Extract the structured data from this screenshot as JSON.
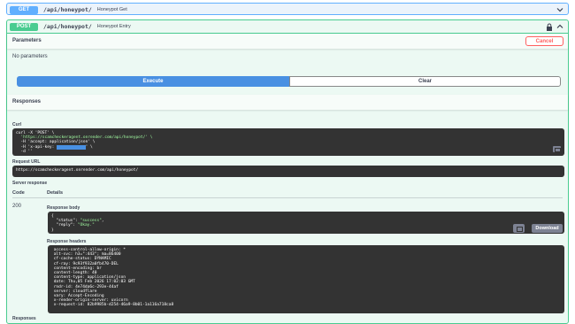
{
  "get_endpoint": {
    "method": "GET",
    "path": "/api/honeypot/",
    "summary": "Honeypot Get"
  },
  "post_endpoint": {
    "method": "POST",
    "path": "/api/honeypot/",
    "summary": "Honeypot Entry"
  },
  "parameters": {
    "title": "Parameters",
    "cancel_label": "Cancel",
    "empty_text": "No parameters"
  },
  "actions": {
    "execute_label": "Execute",
    "clear_label": "Clear"
  },
  "responses": {
    "title": "Responses",
    "curl_label": "Curl",
    "curl_lines": [
      "curl -X 'POST' \\",
      "  'https://scamcheckeragent.onrender.com/api/honeypot/' \\",
      "  -H 'accept: application/json' \\",
      "  -H 'x-api-key: ",
      "' \\",
      "  -d ''"
    ],
    "request_url_label": "Request URL",
    "request_url": "https://scamcheckeragent.onrender.com/api/honeypot/",
    "server_response_label": "Server response",
    "code_header": "Code",
    "details_header": "Details",
    "status_code": "200",
    "response_body_label": "Response body",
    "response_body_lines": [
      "{",
      "  \"status\": ",
      "\"success\"",
      ",",
      "  \"reply\": ",
      "\"Okay.\"",
      "}"
    ],
    "download_label": "Download",
    "response_headers_label": "Response headers",
    "response_headers": [
      " access-control-allow-origin: *",
      " alt-svc: h3=\":443\"; ma=86400",
      " cf-cache-status: DYNAMIC",
      " cf-ray: 9c93f932a0fb470-DEL",
      " content-encoding: br",
      " content-length: 40",
      " content-type: application/json",
      " date: Thu,05 Feb 2026 17:02:03 GMT",
      " rndr-id: 4e74da6c-293e-44af",
      " server: cloudflare",
      " vary: Accept-Encoding",
      " x-render-origin-server: uvicorn",
      " x-request-id: 82b9985b-d254-46a9-8b01-1a116a718ca8"
    ],
    "footer_label": "Responses"
  }
}
